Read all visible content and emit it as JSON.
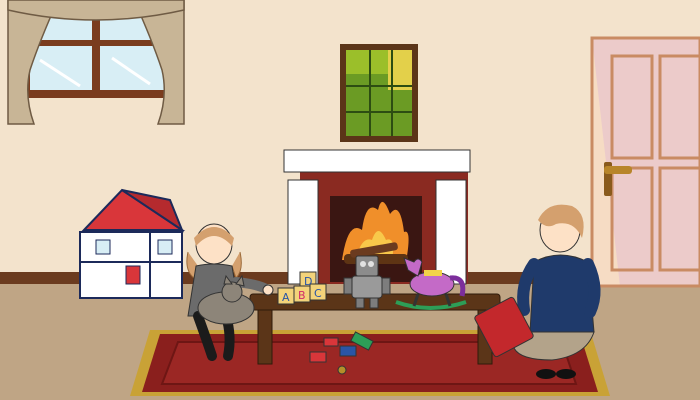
{
  "scene": {
    "name": "living-room-playtime",
    "colors": {
      "wall": "#f3e3cc",
      "floor": "#bfa585",
      "baseboard": "#6b3b1f",
      "rug_outer": "#c9a236",
      "rug_red": "#8a1f1d",
      "rug_inner": "#9b2724",
      "fireplace_white": "#ffffff",
      "fireplace_brick": "#8a2a21",
      "fire": "#f08f2a",
      "table_wood": "#5b3518",
      "door": "#f6dcc4",
      "door_shadow": "#e6bfcf",
      "curtain": "#c8b596",
      "window_frame": "#7a3c1e",
      "painting_frame": "#5b3518",
      "painting_green": "#6b9b24",
      "dollhouse_red": "#d9363a",
      "dollhouse_wall": "#ffffff",
      "horse": "#c46ac7",
      "girl_hair": "#d4a06e",
      "girl_dress": "#6b6b6b",
      "woman_top": "#1f3a6b",
      "woman_pants": "#b3a38a",
      "book_red": "#c3282c"
    },
    "toys": {
      "block_letters": [
        "A",
        "B",
        "C",
        "D"
      ]
    }
  }
}
